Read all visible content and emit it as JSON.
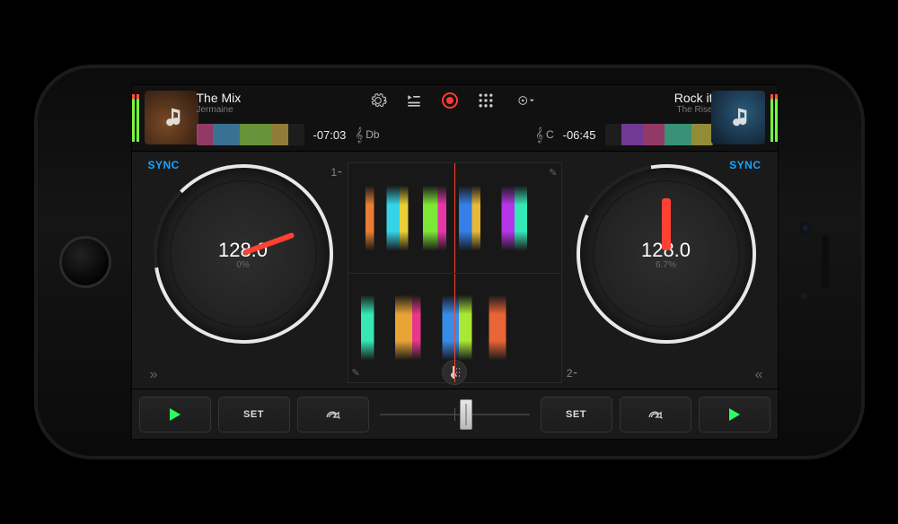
{
  "decks": {
    "left": {
      "title": "The Mix",
      "artist": "Jermaine",
      "time": "-07:03",
      "key": "Db",
      "bpm": "128.0",
      "pct": "0%",
      "sync": "SYNC",
      "track_num": "1"
    },
    "right": {
      "title": "Rock it",
      "artist": "The Rise",
      "time": "-06:45",
      "key": "C",
      "bpm": "128.0",
      "pct": "6.7%",
      "sync": "SYNC",
      "track_num": "2"
    }
  },
  "toolbar": {
    "settings": "⚙",
    "queue": "▤",
    "record": "●",
    "grid": "⠿",
    "automix": "◎▾"
  },
  "footer": {
    "play": "▶",
    "set": "SET",
    "redo": "↷"
  },
  "expand": {
    "left": "»",
    "right": "«"
  },
  "clef": "𝄞",
  "pencil": "✎",
  "tick": "⁃"
}
